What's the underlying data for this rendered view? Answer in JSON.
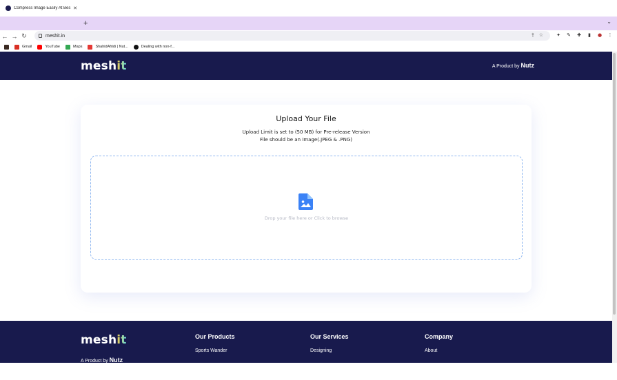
{
  "browser": {
    "tab_title": "Compress Image Easily At Bes",
    "new_tab": "+",
    "url": "meshit.in",
    "bookmarks": [
      {
        "label": "Gmail",
        "icon": "gmail-icon",
        "color": "#d93025"
      },
      {
        "label": "YouTube",
        "icon": "youtube-icon",
        "color": "#ff0000"
      },
      {
        "label": "Maps",
        "icon": "maps-icon",
        "color": "#34a853"
      },
      {
        "label": "ShahidAfridi | Nut...",
        "icon": "z-icon",
        "color": "#e53935"
      },
      {
        "label": "Dealing with non-f...",
        "icon": "github-icon",
        "color": "#111111"
      }
    ]
  },
  "header": {
    "logo_main": "mesh",
    "logo_accent": "it",
    "byline_prefix": "A Product by",
    "byline_brand": "Nutz"
  },
  "upload": {
    "title": "Upload Your File",
    "limit_text": "Upload Limit is set to (50 MB) for Pre-release Version",
    "type_text": "File should be an Image(.JPEG & .PNG)",
    "drop_text": "Drop your file here or Click to browse"
  },
  "footer": {
    "logo_main": "mesh",
    "logo_accent": "it",
    "byline_prefix": "A Product by",
    "byline_brand": "Nutz",
    "columns": [
      {
        "heading": "Our Products",
        "link": "Sports Wander"
      },
      {
        "heading": "Our Services",
        "link": "Designing"
      },
      {
        "heading": "Company",
        "link": "About"
      }
    ]
  },
  "colors": {
    "brand_navy": "#181a4d",
    "dropzone_border": "#8fb7f0",
    "icon_blue": "#3b82f6"
  }
}
